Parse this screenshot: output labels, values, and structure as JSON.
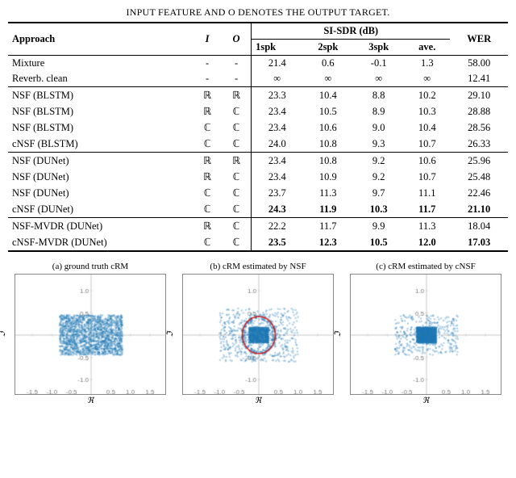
{
  "caption": "INPUT FEATURE AND O DENOTES THE OUTPUT TARGET.",
  "table": {
    "col_headers": [
      "Approach",
      "I",
      "O",
      "1spk",
      "2spk",
      "3spk",
      "ave.",
      "WER"
    ],
    "si_sdr_label": "SI-SDR (dB)",
    "rows": [
      {
        "approach": "Mixture",
        "I": "-",
        "O": "-",
        "s1": "21.4",
        "s2": "0.6",
        "s3": "-0.1",
        "ave": "1.3",
        "wer": "58.00",
        "separator": false,
        "group_start": false,
        "bold_cols": []
      },
      {
        "approach": "Reverb. clean",
        "I": "-",
        "O": "-",
        "s1": "∞",
        "s2": "∞",
        "s3": "∞",
        "ave": "∞",
        "wer": "12.41",
        "separator": false,
        "group_start": false,
        "bold_cols": []
      },
      {
        "approach": "NSF (BLSTM)",
        "I": "ℝ",
        "O": "ℝ",
        "s1": "23.3",
        "s2": "10.4",
        "s3": "8.8",
        "ave": "10.2",
        "wer": "29.10",
        "separator": true,
        "group_start": true,
        "bold_cols": []
      },
      {
        "approach": "NSF (BLSTM)",
        "I": "ℝ",
        "O": "ℂ",
        "s1": "23.4",
        "s2": "10.5",
        "s3": "8.9",
        "ave": "10.3",
        "wer": "28.88",
        "separator": false,
        "group_start": false,
        "bold_cols": []
      },
      {
        "approach": "NSF (BLSTM)",
        "I": "ℂ",
        "O": "ℂ",
        "s1": "23.4",
        "s2": "10.6",
        "s3": "9.0",
        "ave": "10.4",
        "wer": "28.56",
        "separator": false,
        "group_start": false,
        "bold_cols": []
      },
      {
        "approach": "cNSF (BLSTM)",
        "I": "ℂ",
        "O": "ℂ",
        "s1": "24.0",
        "s2": "10.8",
        "s3": "9.3",
        "ave": "10.7",
        "wer": "26.33",
        "separator": false,
        "group_start": false,
        "bold_cols": []
      },
      {
        "approach": "NSF (DUNet)",
        "I": "ℝ",
        "O": "ℝ",
        "s1": "23.4",
        "s2": "10.8",
        "s3": "9.2",
        "ave": "10.6",
        "wer": "25.96",
        "separator": true,
        "group_start": true,
        "bold_cols": []
      },
      {
        "approach": "NSF (DUNet)",
        "I": "ℝ",
        "O": "ℂ",
        "s1": "23.4",
        "s2": "10.9",
        "s3": "9.2",
        "ave": "10.7",
        "wer": "25.48",
        "separator": false,
        "group_start": false,
        "bold_cols": []
      },
      {
        "approach": "NSF (DUNet)",
        "I": "ℂ",
        "O": "ℂ",
        "s1": "23.7",
        "s2": "11.3",
        "s3": "9.7",
        "ave": "11.1",
        "wer": "22.46",
        "separator": false,
        "group_start": false,
        "bold_cols": []
      },
      {
        "approach": "cNSF (DUNet)",
        "I": "ℂ",
        "O": "ℂ",
        "s1": "24.3",
        "s2": "11.9",
        "s3": "10.3",
        "ave": "11.7",
        "wer": "21.10",
        "separator": false,
        "group_start": false,
        "bold_cols": [
          "s1",
          "s2",
          "s3",
          "ave",
          "wer"
        ]
      },
      {
        "approach": "NSF-MVDR (DUNet)",
        "I": "ℝ",
        "O": "ℂ",
        "s1": "22.2",
        "s2": "11.7",
        "s3": "9.9",
        "ave": "11.3",
        "wer": "18.04",
        "separator": true,
        "group_start": true,
        "bold_cols": []
      },
      {
        "approach": "cNSF-MVDR (DUNet)",
        "I": "ℂ",
        "O": "ℂ",
        "s1": "23.5",
        "s2": "12.3",
        "s3": "10.5",
        "ave": "12.0",
        "wer": "17.03",
        "separator": false,
        "group_start": false,
        "bold_cols": [
          "s1",
          "s2",
          "s3",
          "ave",
          "wer"
        ]
      }
    ]
  },
  "plots": [
    {
      "label": "(a) ground truth cRM",
      "has_circle": false
    },
    {
      "label": "(b) cRM estimated by NSF",
      "has_circle": true
    },
    {
      "label": "(c) cRM estimated by cNSF",
      "has_circle": false
    }
  ],
  "axis_label": {
    "y": "ℑ",
    "x": "ℜ"
  }
}
